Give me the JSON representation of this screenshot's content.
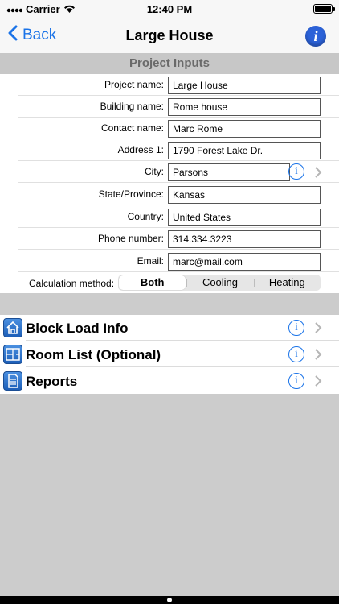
{
  "status_bar": {
    "carrier": "Carrier",
    "time": "12:40 PM"
  },
  "nav": {
    "back_label": "Back",
    "title": "Large House",
    "info_glyph": "i"
  },
  "section": {
    "title": "Project Inputs"
  },
  "form": {
    "fields": [
      {
        "label": "Project name:",
        "value": "Large House"
      },
      {
        "label": "Building name:",
        "value": "Rome house"
      },
      {
        "label": "Contact name:",
        "value": "Marc Rome"
      },
      {
        "label": "Address 1:",
        "value": "1790 Forest Lake Dr."
      },
      {
        "label": "City:",
        "value": "Parsons"
      },
      {
        "label": "State/Province:",
        "value": "Kansas"
      },
      {
        "label": "Country:",
        "value": "United States"
      },
      {
        "label": "Phone number:",
        "value": "314.334.3223"
      },
      {
        "label": "Email:",
        "value": "marc@mail.com"
      }
    ],
    "calculation": {
      "label": "Calculation method:",
      "options": [
        "Both",
        "Cooling",
        "Heating"
      ],
      "selected": "Both"
    }
  },
  "menu": [
    {
      "label": "Block Load Info",
      "icon": "house-icon"
    },
    {
      "label": "Room List (Optional)",
      "icon": "floorplan-icon"
    },
    {
      "label": "Reports",
      "icon": "document-icon"
    }
  ],
  "info_glyph": "i",
  "colors": {
    "accent": "#1a73e8",
    "nav_info": "#2c62d8",
    "section_header": "#c7c7c7",
    "background": "#cccccc"
  }
}
